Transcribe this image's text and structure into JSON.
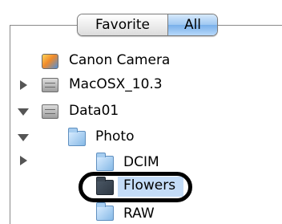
{
  "tabs": {
    "favorite_label": "Favorite",
    "all_label": "All"
  },
  "tree": [
    {
      "label": "Canon Camera",
      "icon": "camera-icon",
      "toggle": "none"
    },
    {
      "label": "MacOSX_10.3",
      "icon": "hard-disk-icon",
      "toggle": "collapsed"
    },
    {
      "label": "Data01",
      "icon": "hard-disk-icon",
      "toggle": "expanded"
    },
    {
      "label": "Photo",
      "icon": "folder-icon",
      "toggle": "expanded"
    },
    {
      "label": "DCIM",
      "icon": "folder-icon",
      "toggle": "collapsed"
    },
    {
      "label": "Flowers",
      "icon": "folder-icon",
      "toggle": "none",
      "selected": true
    },
    {
      "label": "RAW",
      "icon": "folder-icon",
      "toggle": "none"
    }
  ],
  "colors": {
    "selection": "#c4dcf7",
    "tab_active": "#79b0ea",
    "annotation": "#000000"
  }
}
